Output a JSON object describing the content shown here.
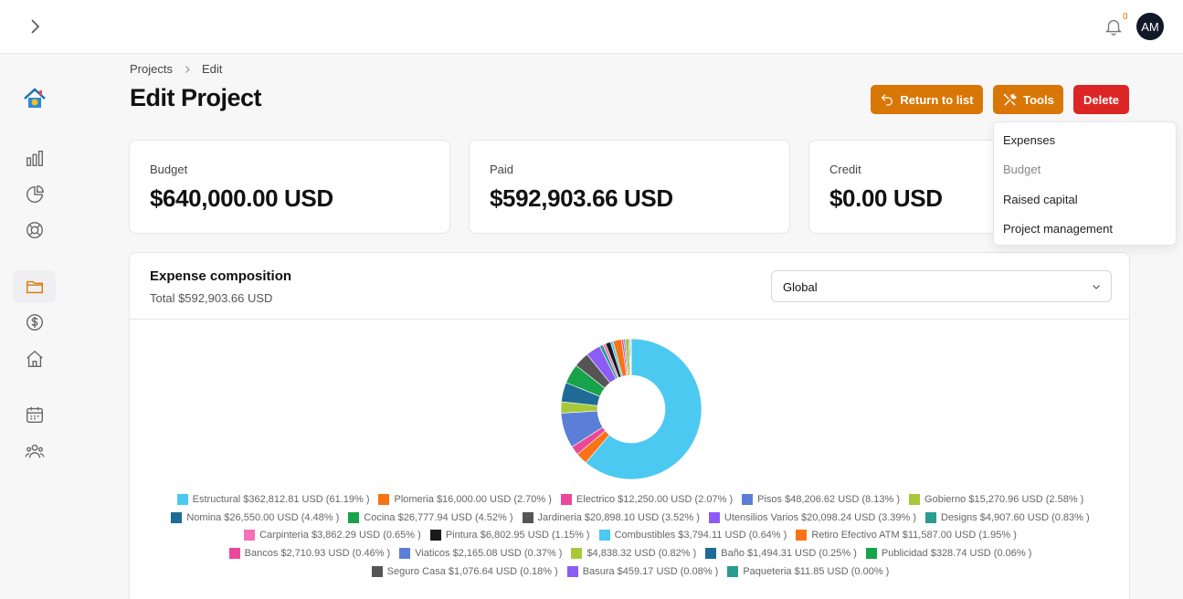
{
  "header": {
    "notification_count": "0",
    "avatar_initials": "AM"
  },
  "breadcrumb": {
    "items": [
      "Projects",
      "Edit"
    ]
  },
  "page_title": "Edit Project",
  "actions": {
    "return_label": "Return to list",
    "tools_label": "Tools",
    "delete_label": "Delete"
  },
  "tools_menu": {
    "items": [
      "Expenses",
      "Budget",
      "Raised capital",
      "Project management"
    ]
  },
  "cards": [
    {
      "label": "Budget",
      "value": "$640,000.00 USD"
    },
    {
      "label": "Paid",
      "value": "$592,903.66 USD"
    },
    {
      "label": "Credit",
      "value": "$0.00 USD"
    }
  ],
  "expenses": {
    "title": "Expense composition",
    "total": "Total $592,903.66 USD",
    "filter_value": "Global"
  },
  "chart_data": {
    "type": "pie",
    "categories": [
      "Estructural",
      "Plomeria",
      "Electrico",
      "Pisos",
      "Gobierno",
      "Nomina",
      "Cocina",
      "Jardineria",
      "Utensilios Varios",
      "Designs",
      "Carpinteria",
      "Pintura",
      "Combustibles",
      "Retiro Efectivo ATM",
      "Bancos",
      "Viaticos",
      "",
      "Baño",
      "Publicidad",
      "Seguro Casa",
      "Basura",
      "Paqueteria"
    ],
    "values": [
      362812.81,
      16000.0,
      12250.0,
      48206.62,
      15270.96,
      26550.0,
      26777.94,
      20898.1,
      20098.24,
      4907.6,
      3862.29,
      6802.95,
      3794.11,
      11587.0,
      2710.93,
      2165.08,
      4838.32,
      1494.31,
      328.74,
      1076.64,
      459.17,
      11.85
    ],
    "labels": [
      "Estructural $362,812.81 USD (61.19% )",
      "Plomeria $16,000.00 USD (2.70% )",
      "Electrico $12,250.00 USD (2.07% )",
      "Pisos $48,206.62 USD (8.13% )",
      "Gobierno $15,270.96 USD (2.58% )",
      "Nomina $26,550.00 USD (4.48% )",
      "Cocina $26,777.94 USD (4.52% )",
      "Jardineria $20,898.10 USD (3.52% )",
      "Utensilios Varios $20,098.24 USD (3.39% )",
      "Designs $4,907.60 USD (0.83% )",
      "Carpinteria $3,862.29 USD (0.65% )",
      "Pintura $6,802.95 USD (1.15% )",
      "Combustibles $3,794.11 USD (0.64% )",
      "Retiro Efectivo ATM $11,587.00 USD (1.95% )",
      "Bancos $2,710.93 USD (0.46% )",
      "Viaticos $2,165.08 USD (0.37% )",
      "$4,838.32 USD (0.82% )",
      "Baño $1,494.31 USD (0.25% )",
      "Publicidad $328.74 USD (0.06% )",
      "Seguro Casa $1,076.64 USD (0.18% )",
      "Basura $459.17 USD (0.08% )",
      "Paqueteria $11.85 USD (0.00% )"
    ],
    "colors": [
      "#4cc9f0",
      "#f97316",
      "#ec4899",
      "#5b7fd6",
      "#a8c83a",
      "#1e6b96",
      "#16a34a",
      "#555555",
      "#8b5cf6",
      "#2a9d8f",
      "#f472b6",
      "#1a1a1a",
      "#4cc9f0",
      "#f97316",
      "#ec4899",
      "#5b7fd6",
      "#a8c83a",
      "#1e6b96",
      "#16a34a",
      "#555555",
      "#8b5cf6",
      "#2a9d8f"
    ],
    "legend_rows": [
      [
        0,
        1,
        2,
        3,
        4
      ],
      [
        5,
        6,
        7,
        8,
        9
      ],
      [
        10,
        11,
        12,
        13
      ],
      [
        14,
        15,
        16,
        17,
        18
      ],
      [
        19,
        20,
        21
      ]
    ]
  }
}
